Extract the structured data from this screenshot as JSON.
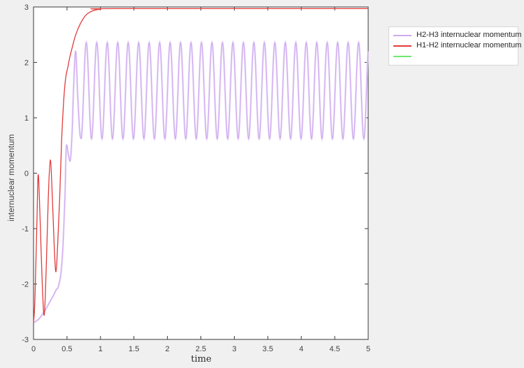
{
  "figure": {
    "background_color": "#f0f0f0",
    "plot_background_color": "#ffffff",
    "frame_color": "#3a3a3a",
    "tick_label_color": "#424242"
  },
  "chart_data": {
    "type": "line",
    "title": "",
    "xlabel": "time",
    "ylabel": "internuclear momentum",
    "xlim": [
      0,
      5
    ],
    "ylim": [
      -3,
      3
    ],
    "grid": false,
    "xticks": {
      "values": [
        0,
        0.5,
        1,
        1.5,
        2,
        2.5,
        3,
        3.5,
        4,
        4.5,
        5
      ],
      "labels": [
        "0",
        "0.5",
        "1",
        "1.5",
        "2",
        "2.5",
        "3",
        "3.5",
        "4",
        "4.5",
        "5"
      ]
    },
    "yticks": {
      "values": [
        -3,
        -2,
        -1,
        0,
        1,
        2,
        3
      ],
      "labels": [
        "-3",
        "-2",
        "-1",
        "0",
        "1",
        "2",
        "3"
      ]
    },
    "legend": {
      "position": "outside-top-right",
      "background": "#ffffff",
      "border_color": "#d7d7d7"
    },
    "series": [
      {
        "name": "H2-H3 internuclear momentum",
        "color": "#cfa9ef",
        "halo_color": "#e9dcf9",
        "line_width": 1.2,
        "keypoints": [
          [
            0.0,
            -2.7
          ],
          [
            0.08,
            -2.63
          ],
          [
            0.16,
            -2.5
          ],
          [
            0.24,
            -2.33
          ],
          [
            0.3,
            -2.2
          ],
          [
            0.34,
            -2.1
          ],
          [
            0.37,
            -2.05
          ],
          [
            0.41,
            -1.8
          ],
          [
            0.44,
            -1.3
          ],
          [
            0.47,
            -0.4
          ],
          [
            0.49,
            0.48
          ],
          [
            0.525,
            0.3
          ],
          [
            0.55,
            0.24
          ],
          [
            0.575,
            0.7
          ],
          [
            0.6,
            1.6
          ],
          [
            0.63,
            2.2
          ],
          [
            0.66,
            1.4
          ],
          [
            0.69,
            0.75
          ],
          [
            0.71,
            0.62
          ]
        ],
        "oscillation": {
          "start": 0.71,
          "end": 5.0,
          "mean": 1.49,
          "amplitude": 0.87,
          "period": 0.1565,
          "peak_time": 0.788,
          "range": [
            0.62,
            2.36
          ]
        }
      },
      {
        "name": "H1-H2 internuclear momentum",
        "color": "#e23b3b",
        "line_width": 1.3,
        "keypoints": [
          [
            0.0,
            -2.7
          ],
          [
            0.02,
            -2.3
          ],
          [
            0.05,
            -0.9
          ],
          [
            0.07,
            -0.02
          ],
          [
            0.1,
            -0.9
          ],
          [
            0.13,
            -2.0
          ],
          [
            0.16,
            -2.56
          ],
          [
            0.19,
            -1.7
          ],
          [
            0.22,
            -0.45
          ],
          [
            0.25,
            0.24
          ],
          [
            0.28,
            -0.4
          ],
          [
            0.31,
            -1.35
          ],
          [
            0.335,
            -1.78
          ],
          [
            0.36,
            -1.3
          ],
          [
            0.39,
            -0.45
          ],
          [
            0.42,
            0.6
          ],
          [
            0.45,
            1.3
          ],
          [
            0.48,
            1.72
          ],
          [
            0.51,
            1.9
          ],
          [
            0.54,
            2.08
          ],
          [
            0.58,
            2.28
          ],
          [
            0.63,
            2.5
          ],
          [
            0.7,
            2.7
          ],
          [
            0.78,
            2.85
          ],
          [
            0.88,
            2.93
          ],
          [
            1.0,
            2.96
          ],
          [
            1.2,
            2.97
          ],
          [
            5.0,
            2.97
          ]
        ],
        "steady_state_value": 2.97
      },
      {
        "name": "",
        "color": "#6fe96f",
        "line_width": 2,
        "keypoints": []
      }
    ]
  }
}
